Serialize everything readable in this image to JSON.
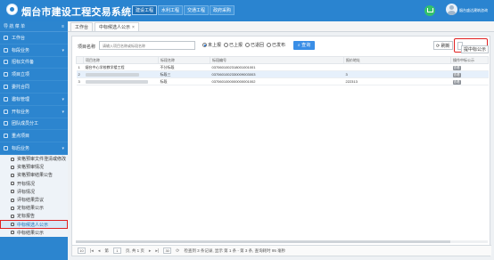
{
  "app": {
    "title": "烟台市建设工程交易系统",
    "user_name": "烟台盛达建筑咨询",
    "accent": "#2a84d0",
    "highlight": "#e02020"
  },
  "topnav": [
    {
      "label": "建设工程",
      "active": true
    },
    {
      "label": "水利工程",
      "active": false
    },
    {
      "label": "交通工程",
      "active": false
    },
    {
      "label": "政府采购",
      "active": false
    }
  ],
  "icons": {
    "home": "home-icon",
    "user": "avatar-icon"
  },
  "sidebar": {
    "header": "导 航 菜 单",
    "collapse_icon": "≡",
    "items": [
      {
        "label": "工作台",
        "chev": ""
      },
      {
        "label": "标段业务",
        "chev": "▾"
      },
      {
        "label": "招标文件备",
        "chev": ""
      },
      {
        "label": "项目立项",
        "chev": ""
      },
      {
        "label": "委托合同",
        "chev": ""
      },
      {
        "label": "邀标管理",
        "chev": "▾"
      },
      {
        "label": "开标业务",
        "chev": "▾"
      },
      {
        "label": "团队成员分工",
        "chev": ""
      },
      {
        "label": "重点项目",
        "chev": ""
      },
      {
        "label": "标后业务",
        "chev": "▾"
      }
    ],
    "subitems": [
      "资格预审文件澄清或修改",
      "资格预审情况",
      "资格预审结果公告",
      "开标情况",
      "评标情况",
      "评标结果异议",
      "定标结果公示",
      "定标报告",
      "中标候选人公示",
      "中标结果公示"
    ],
    "active_subitem": "中标候选人公示"
  },
  "tabs": [
    {
      "label": "工作台",
      "closable": false,
      "active": false
    },
    {
      "label": "中标候选人公示",
      "closable": true,
      "active": true
    }
  ],
  "filters": {
    "label": "项目名称",
    "placeholder": "请输入项目名称或标段名称",
    "radios": [
      {
        "label": "未上报",
        "checked": true
      },
      {
        "label": "已上报",
        "checked": false
      },
      {
        "label": "已退回",
        "checked": false
      },
      {
        "label": "已发布",
        "checked": false
      }
    ],
    "query_label": "查询",
    "refresh_label": "刷新",
    "submit_label": "提中标公示"
  },
  "table": {
    "columns": [
      "项目名称",
      "标段名称",
      "标段编号",
      "报价地址",
      "操作中标公示"
    ],
    "rows": [
      {
        "no": "1",
        "project": "烟台中心学校教学楼工程",
        "section": "不分标段",
        "code": "0370601002318001001001",
        "address": "",
        "action": "查看",
        "selected": false
      },
      {
        "no": "2",
        "project": "",
        "section": "标段三",
        "code": "0370601002330009003003",
        "address": "3",
        "action": "查看",
        "selected": true
      },
      {
        "no": "3",
        "project": "",
        "section": "标段",
        "code": "0370601000000000001002",
        "address": "222313",
        "action": "查看",
        "selected": false
      }
    ]
  },
  "pager": {
    "page_size": "10",
    "page_prefix": "第",
    "page_value": "1",
    "page_suffix": "页, 共 1 页",
    "per_page": "30",
    "summary": "检查到 3 条记录, 显示 第 1 条 - 第 3 条, 查询耗时 95 毫秒"
  }
}
